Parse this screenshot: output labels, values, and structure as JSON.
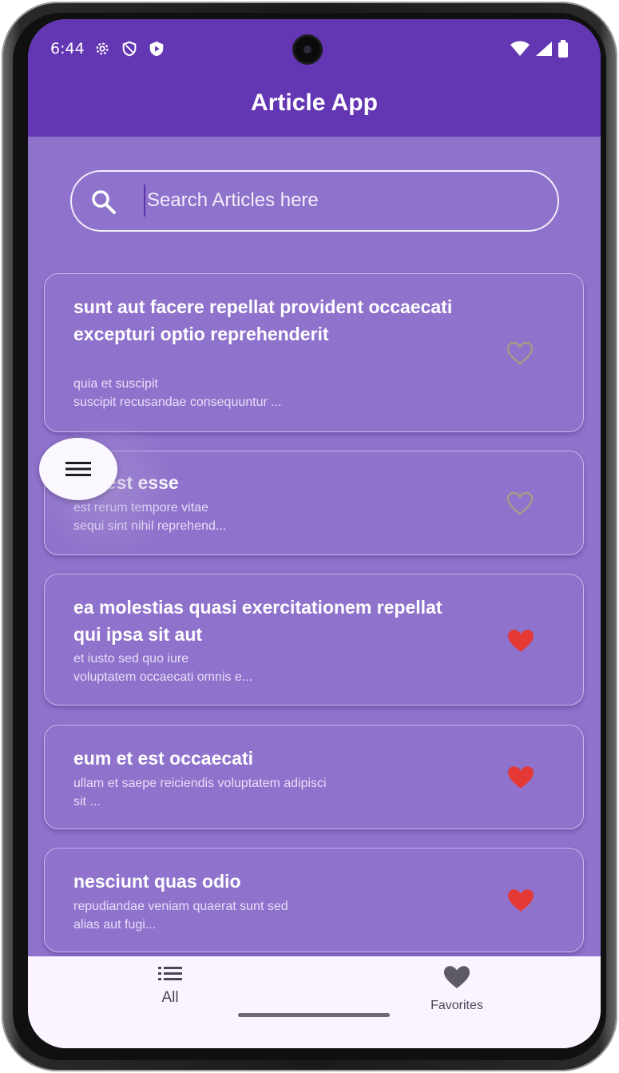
{
  "status_bar": {
    "time": "6:44",
    "left_icons": [
      "gear-icon",
      "shield-outline-icon",
      "shield-play-icon"
    ],
    "right_icons": [
      "wifi-icon",
      "signal-icon",
      "battery-icon"
    ]
  },
  "app_bar": {
    "title": "Article App"
  },
  "search": {
    "placeholder": "Search Articles here",
    "value": ""
  },
  "articles": [
    {
      "title": "sunt aut facere repellat provident occaecati excepturi optio reprehenderit",
      "body_line1": "quia et suscipit",
      "body_line2": "suscipit recusandae consequuntur ...",
      "favorite": false
    },
    {
      "title": "qui est esse",
      "body_line1": "est rerum tempore vitae",
      "body_line2": "sequi sint nihil reprehend...",
      "favorite": false
    },
    {
      "title": "ea molestias quasi exercitationem repellat qui ipsa sit aut",
      "body_line1": "et iusto sed quo iure",
      "body_line2": "voluptatem occaecati omnis e...",
      "favorite": true
    },
    {
      "title": "eum et est occaecati",
      "body_line1": "ullam et saepe reiciendis voluptatem adipisci",
      "body_line2": "sit ...",
      "favorite": true
    },
    {
      "title": "nesciunt quas odio",
      "body_line1": "repudiandae veniam quaerat sunt sed",
      "body_line2": "alias aut fugi...",
      "favorite": true
    }
  ],
  "bottom_nav": {
    "items": [
      {
        "label": "All",
        "icon": "list-icon",
        "active": true
      },
      {
        "label": "Favorites",
        "icon": "heart-icon",
        "active": false
      }
    ]
  },
  "colors": {
    "app_bar": "#6336b4",
    "background": "#8f72cc",
    "favorite_active": "#e53935",
    "favorite_inactive": "#a89a84",
    "bottom_nav": "#fbf4ff"
  }
}
